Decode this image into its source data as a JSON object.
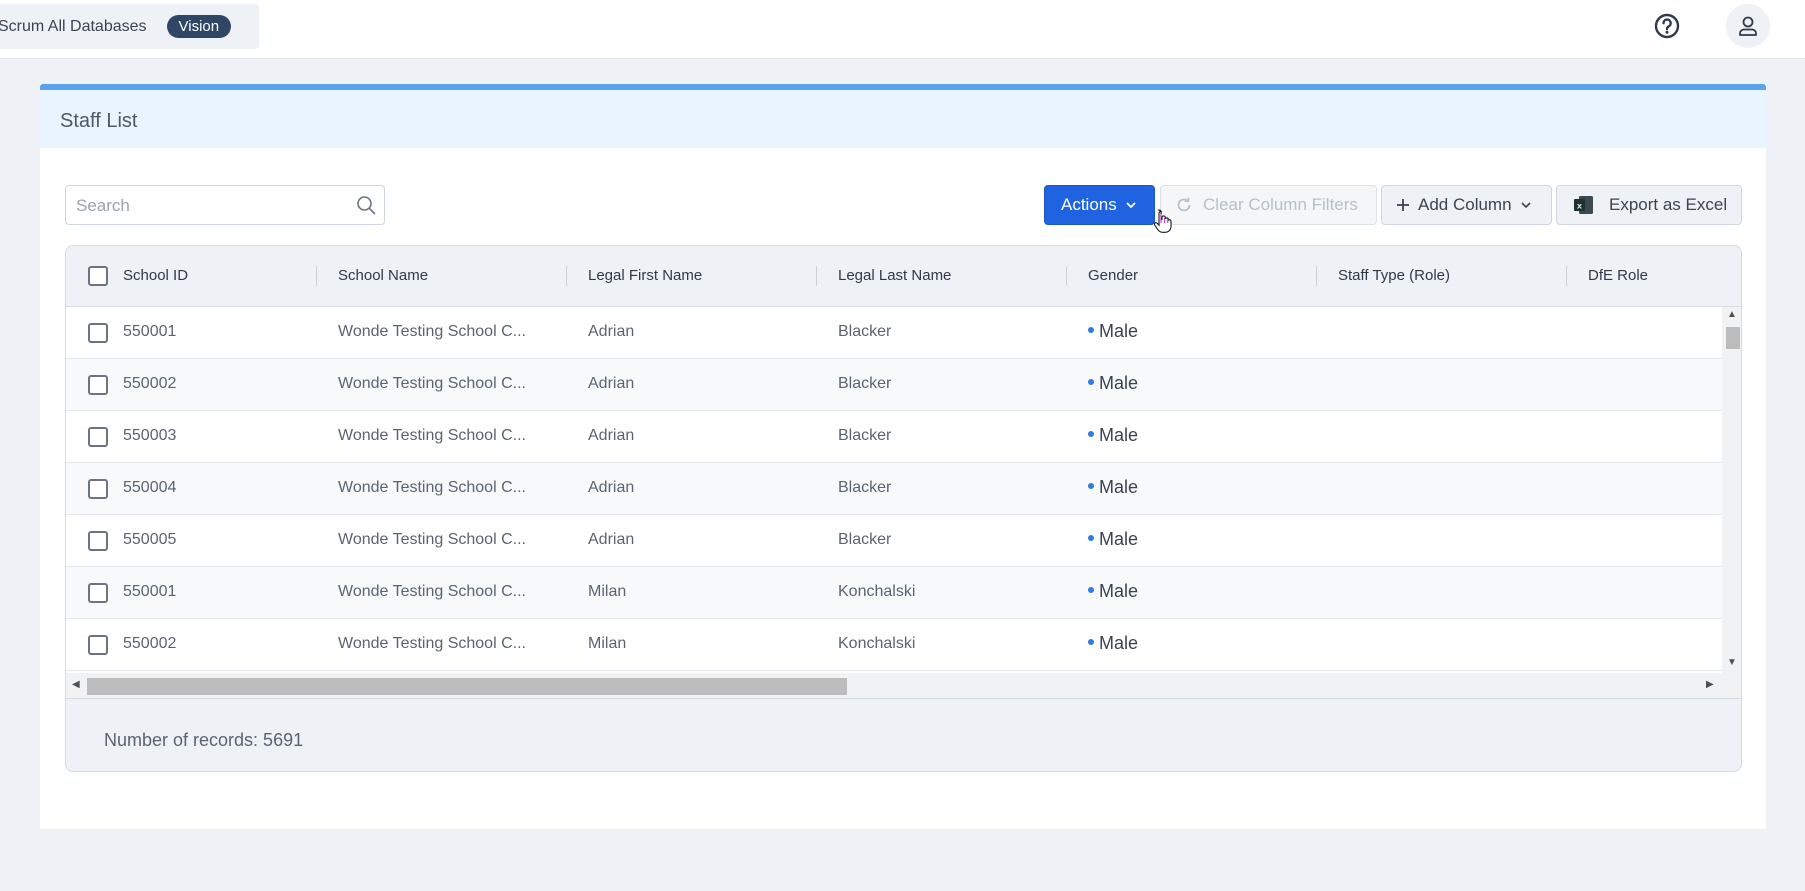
{
  "topbar": {
    "database_label": "Scrum All Databases",
    "badge": "Vision",
    "help_icon": "help-circle-icon",
    "user_icon": "user-icon"
  },
  "card": {
    "title": "Staff List"
  },
  "toolbar": {
    "search_placeholder": "Search",
    "search_value": "",
    "actions_label": "Actions",
    "clear_filters_label": "Clear Column Filters",
    "add_column_label": "Add Column",
    "export_label": "Export as Excel"
  },
  "grid": {
    "columns": [
      "School ID",
      "School Name",
      "Legal First Name",
      "Legal Last Name",
      "Gender",
      "Staff Type (Role)",
      "DfE Role"
    ],
    "rows": [
      {
        "school_id": "550001",
        "school_name": "Wonde Testing School C...",
        "first_name": "Adrian",
        "last_name": "Blacker",
        "gender": "Male",
        "staff_type": "",
        "dfe_role": ""
      },
      {
        "school_id": "550002",
        "school_name": "Wonde Testing School C...",
        "first_name": "Adrian",
        "last_name": "Blacker",
        "gender": "Male",
        "staff_type": "",
        "dfe_role": ""
      },
      {
        "school_id": "550003",
        "school_name": "Wonde Testing School C...",
        "first_name": "Adrian",
        "last_name": "Blacker",
        "gender": "Male",
        "staff_type": "",
        "dfe_role": ""
      },
      {
        "school_id": "550004",
        "school_name": "Wonde Testing School C...",
        "first_name": "Adrian",
        "last_name": "Blacker",
        "gender": "Male",
        "staff_type": "",
        "dfe_role": ""
      },
      {
        "school_id": "550005",
        "school_name": "Wonde Testing School C...",
        "first_name": "Adrian",
        "last_name": "Blacker",
        "gender": "Male",
        "staff_type": "",
        "dfe_role": ""
      },
      {
        "school_id": "550001",
        "school_name": "Wonde Testing School C...",
        "first_name": "Milan",
        "last_name": "Konchalski",
        "gender": "Male",
        "staff_type": "",
        "dfe_role": ""
      },
      {
        "school_id": "550002",
        "school_name": "Wonde Testing School C...",
        "first_name": "Milan",
        "last_name": "Konchalski",
        "gender": "Male",
        "staff_type": "",
        "dfe_role": ""
      }
    ],
    "footer": "Number of records: 5691"
  },
  "colors": {
    "primary": "#1f63e0",
    "header_accent": "#5aa2f0",
    "gender_dot": "#2f7be6",
    "badge_bg": "#2f4664"
  }
}
